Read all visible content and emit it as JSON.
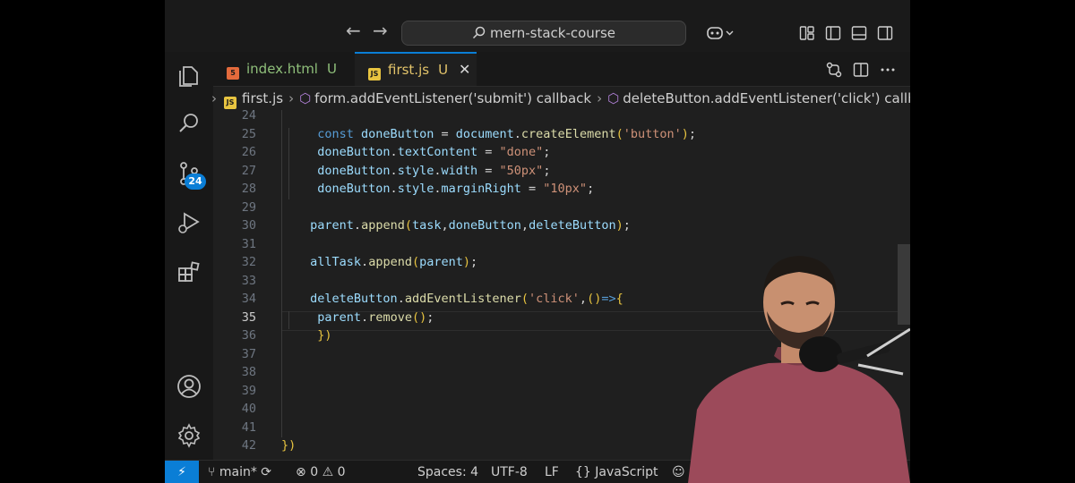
{
  "window": {
    "command_center": "mern-stack-course",
    "nav_back": "←",
    "nav_forward": "→"
  },
  "tabs": [
    {
      "label": "index.html",
      "status": "U",
      "icon": "html5-icon"
    },
    {
      "label": "first.js",
      "status": "U",
      "icon": "js-icon",
      "close": "✕"
    }
  ],
  "breadcrumb": {
    "file": "first.js",
    "symbol1": "form.addEventListener('submit') callback",
    "symbol2": "deleteButton.addEventListener('click') callback"
  },
  "activity": {
    "scm_badge": "24"
  },
  "editor": {
    "current_line": "35",
    "lines": [
      {
        "n": "24",
        "code": ""
      },
      {
        "n": "25",
        "code": "  const doneButton = document.createElement('button');"
      },
      {
        "n": "26",
        "code": "  doneButton.textContent = \"done\";"
      },
      {
        "n": "27",
        "code": "  doneButton.style.width = \"50px\";"
      },
      {
        "n": "28",
        "code": "  doneButton.style.marginRight = \"10px\";"
      },
      {
        "n": "29",
        "code": ""
      },
      {
        "n": "30",
        "code": " parent.append(task,doneButton,deleteButton);"
      },
      {
        "n": "31",
        "code": ""
      },
      {
        "n": "32",
        "code": " allTask.append(parent);"
      },
      {
        "n": "33",
        "code": ""
      },
      {
        "n": "34",
        "code": " deleteButton.addEventListener('click',()=>{"
      },
      {
        "n": "35",
        "code": "  parent.remove();"
      },
      {
        "n": "36",
        "code": "  })"
      },
      {
        "n": "37",
        "code": ""
      },
      {
        "n": "38",
        "code": ""
      },
      {
        "n": "39",
        "code": ""
      },
      {
        "n": "40",
        "code": ""
      },
      {
        "n": "41",
        "code": ""
      },
      {
        "n": "42",
        "code": "})"
      }
    ]
  },
  "statusbar": {
    "remote": "⚡",
    "branch": "main*",
    "errors": "0",
    "warnings": "0",
    "spaces": "Spaces: 4",
    "encoding": "UTF-8",
    "eol": "LF",
    "language": "JavaScript"
  },
  "colors": {
    "accent": "#0a7ed6",
    "keyword": "#569cd6",
    "string": "#ce9178",
    "function": "#dcdcaa",
    "variable": "#9cdcfe"
  }
}
